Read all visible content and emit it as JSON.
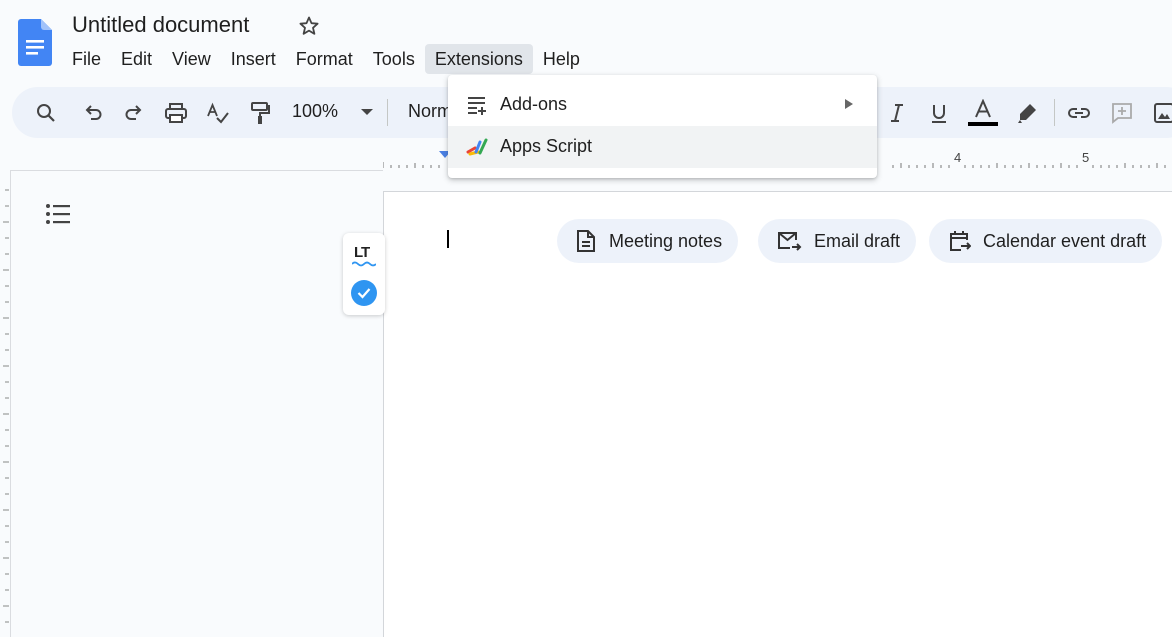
{
  "document": {
    "title": "Untitled document"
  },
  "menubar": {
    "items": [
      {
        "label": "File"
      },
      {
        "label": "Edit"
      },
      {
        "label": "View"
      },
      {
        "label": "Insert"
      },
      {
        "label": "Format"
      },
      {
        "label": "Tools"
      },
      {
        "label": "Extensions"
      },
      {
        "label": "Help"
      }
    ]
  },
  "toolbar": {
    "zoom": "100%",
    "paragraph_style": "Norm"
  },
  "ruler": {
    "labels": [
      "4",
      "5"
    ]
  },
  "extensions_menu": {
    "items": [
      {
        "label": "Add-ons",
        "icon": "add-ons-icon",
        "submenu": true
      },
      {
        "label": "Apps Script",
        "icon": "apps-script-icon",
        "submenu": false
      }
    ]
  },
  "smart_chips": [
    {
      "label": "Meeting notes",
      "icon": "document-icon"
    },
    {
      "label": "Email draft",
      "icon": "email-icon"
    },
    {
      "label": "Calendar event draft",
      "icon": "calendar-icon"
    }
  ],
  "language_tool": {
    "logo": "LT",
    "status": "no-issues"
  },
  "colors": {
    "accent": "#1a73e8",
    "toolbar_bg": "#edf2fa",
    "check_blue": "#2f95f1"
  }
}
